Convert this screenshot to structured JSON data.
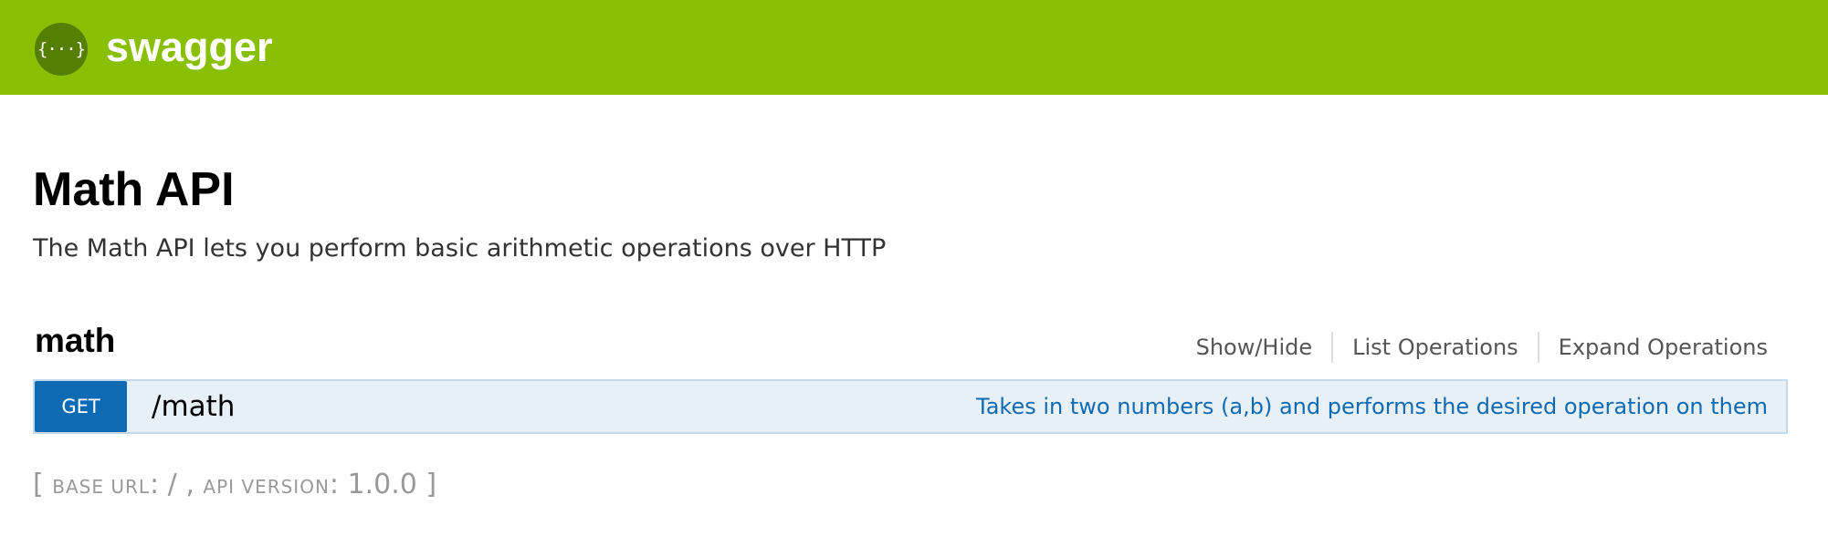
{
  "header": {
    "logo_glyph": "{···}",
    "brand": "swagger",
    "color": "#89bf04"
  },
  "api": {
    "title": "Math API",
    "description": "The Math API lets you perform basic arithmetic operations over HTTP"
  },
  "resource": {
    "name": "math",
    "links": {
      "show_hide": "Show/Hide",
      "list_operations": "List Operations",
      "expand_operations": "Expand Operations"
    }
  },
  "operation": {
    "method": "GET",
    "path": "/math",
    "summary": "Takes in two numbers (a,b) and performs the desired operation on them",
    "method_color": "#0f6ab4"
  },
  "footer": {
    "open_bracket": "[ ",
    "base_url_label": "BASE URL",
    "base_url_value": ": / , ",
    "api_version_label": "API VERSION",
    "api_version_value": ": 1.0.0 ",
    "close_bracket": "]"
  }
}
